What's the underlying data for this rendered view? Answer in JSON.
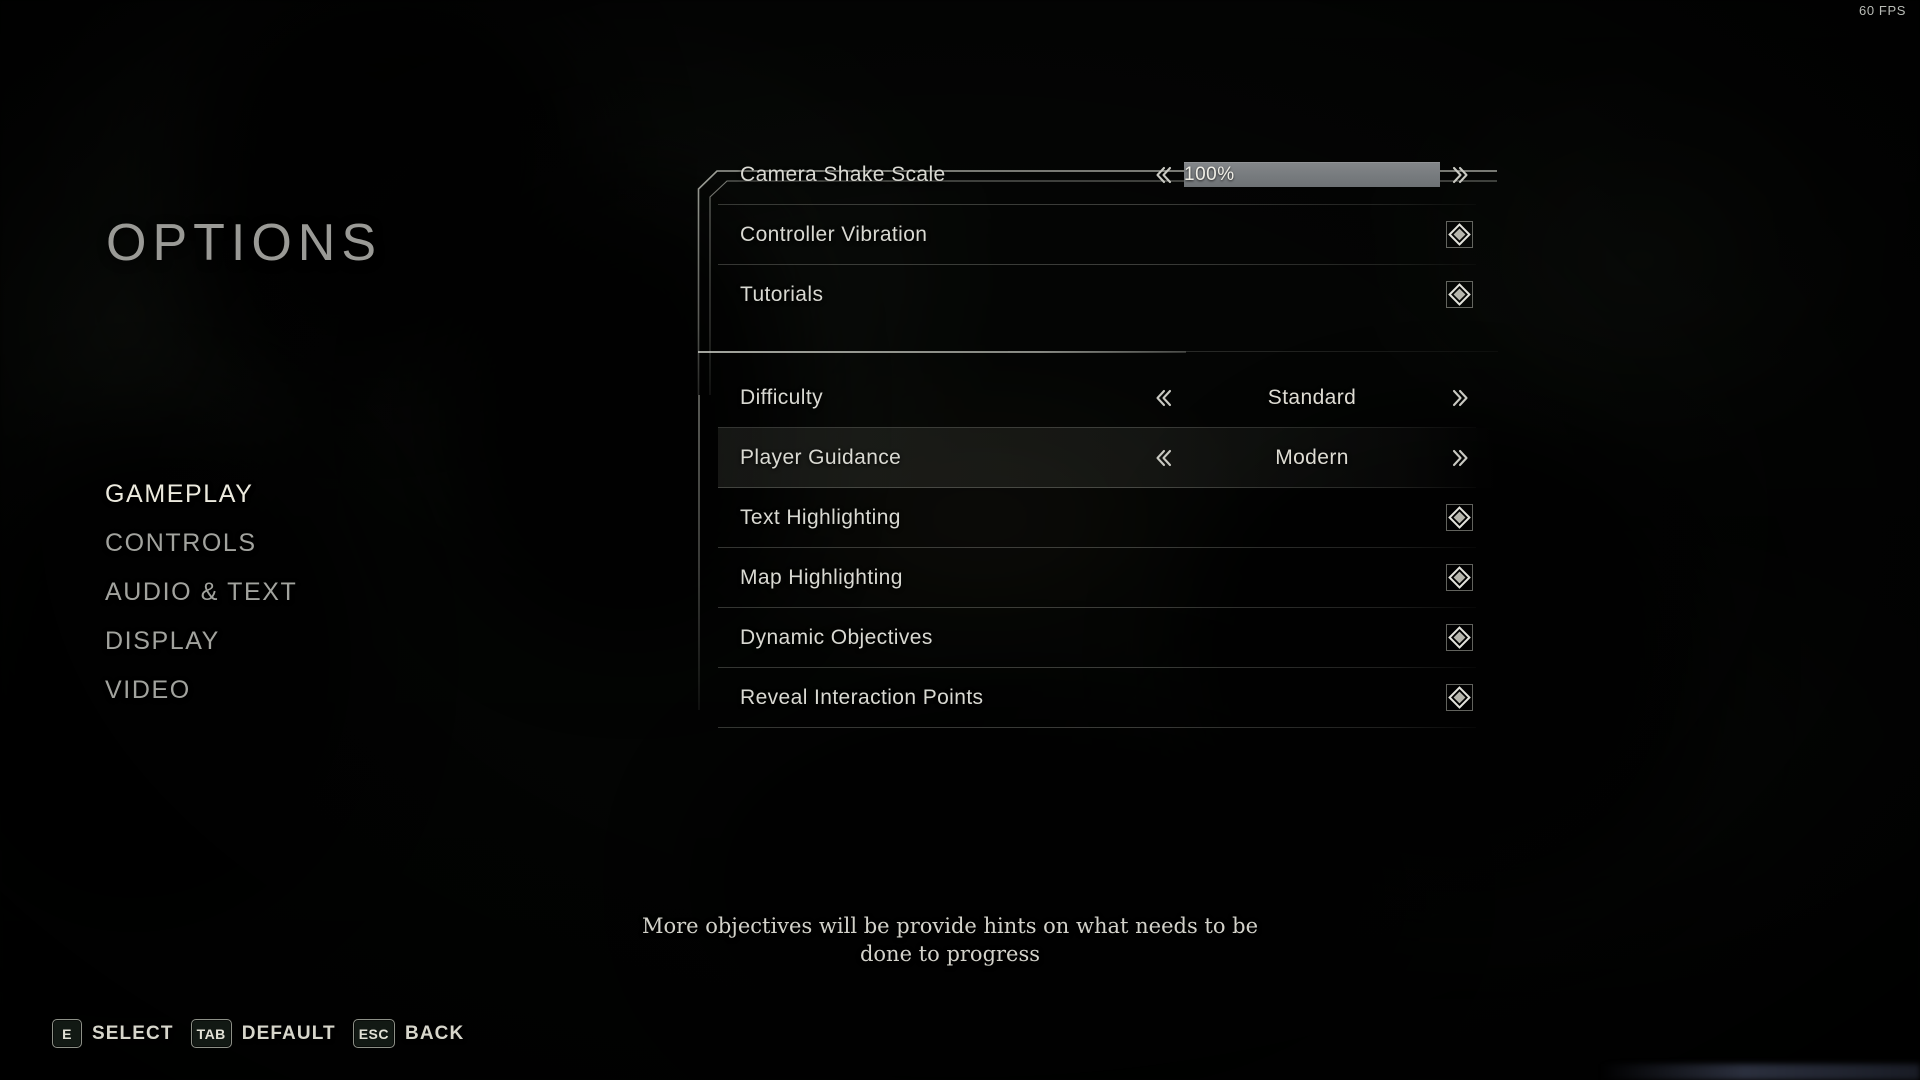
{
  "hud": {
    "fps": "60 FPS"
  },
  "page": {
    "title": "OPTIONS"
  },
  "sidebar": {
    "items": [
      {
        "label": "GAMEPLAY",
        "selected": true
      },
      {
        "label": "CONTROLS",
        "selected": false
      },
      {
        "label": "AUDIO & TEXT",
        "selected": false
      },
      {
        "label": "DISPLAY",
        "selected": false
      },
      {
        "label": "VIDEO",
        "selected": false
      }
    ]
  },
  "options": {
    "group_one": [
      {
        "label": "Camera Shake Scale",
        "control": "slider",
        "value": "100%",
        "fill_percent": 100,
        "selected": false
      },
      {
        "label": "Controller Vibration",
        "control": "checkbox",
        "checked": true,
        "selected": false
      },
      {
        "label": "Tutorials",
        "control": "checkbox",
        "checked": true,
        "selected": false
      }
    ],
    "group_two": [
      {
        "label": "Difficulty",
        "control": "stepper",
        "value": "Standard",
        "selected": false
      },
      {
        "label": "Player Guidance",
        "control": "stepper",
        "value": "Modern",
        "selected": true
      },
      {
        "label": "Text Highlighting",
        "control": "checkbox",
        "checked": true,
        "selected": false
      },
      {
        "label": "Map Highlighting",
        "control": "checkbox",
        "checked": true,
        "selected": false
      },
      {
        "label": "Dynamic Objectives",
        "control": "checkbox",
        "checked": true,
        "selected": false
      },
      {
        "label": "Reveal Interaction Points",
        "control": "checkbox",
        "checked": true,
        "selected": false
      }
    ]
  },
  "description": {
    "text": "More objectives will be provide hints on what needs to be done to progress"
  },
  "footer": {
    "hints": [
      {
        "key": "E",
        "label": "SELECT"
      },
      {
        "key": "TAB",
        "label": "DEFAULT"
      },
      {
        "key": "ESC",
        "label": "BACK"
      }
    ]
  },
  "colors": {
    "accent_highlight": "#eceade",
    "label": "#d9d9d2",
    "muted": "#a2a39e",
    "slider_fill": "#797d80",
    "border": "#a8aaa2"
  }
}
